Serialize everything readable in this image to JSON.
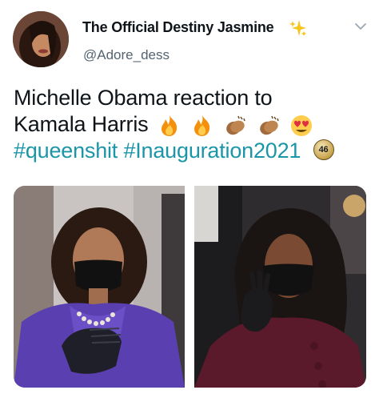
{
  "tweet": {
    "display_name": "The Official Destiny Jasmine",
    "handle": "@Adore_dess",
    "name_emoji": "sparkle-icon",
    "more_icon": "chevron-down-icon",
    "text_line1": "Michelle Obama reaction to",
    "text_line2": "Kamala Harris",
    "text_line2_emojis": [
      "fire-icon",
      "fire-icon",
      "clapping-hands-icon",
      "clapping-hands-icon",
      "heart-eyes-icon"
    ],
    "hashtag1": "#queenshit",
    "hashtag2": "#Inauguration2021",
    "badge_text": "46",
    "hashtag_color": "#1b95a8"
  },
  "media": {
    "images": [
      {
        "name": "kamala-harris-photo",
        "description_icon": "photo"
      },
      {
        "name": "michelle-obama-photo",
        "description_icon": "photo"
      }
    ]
  }
}
